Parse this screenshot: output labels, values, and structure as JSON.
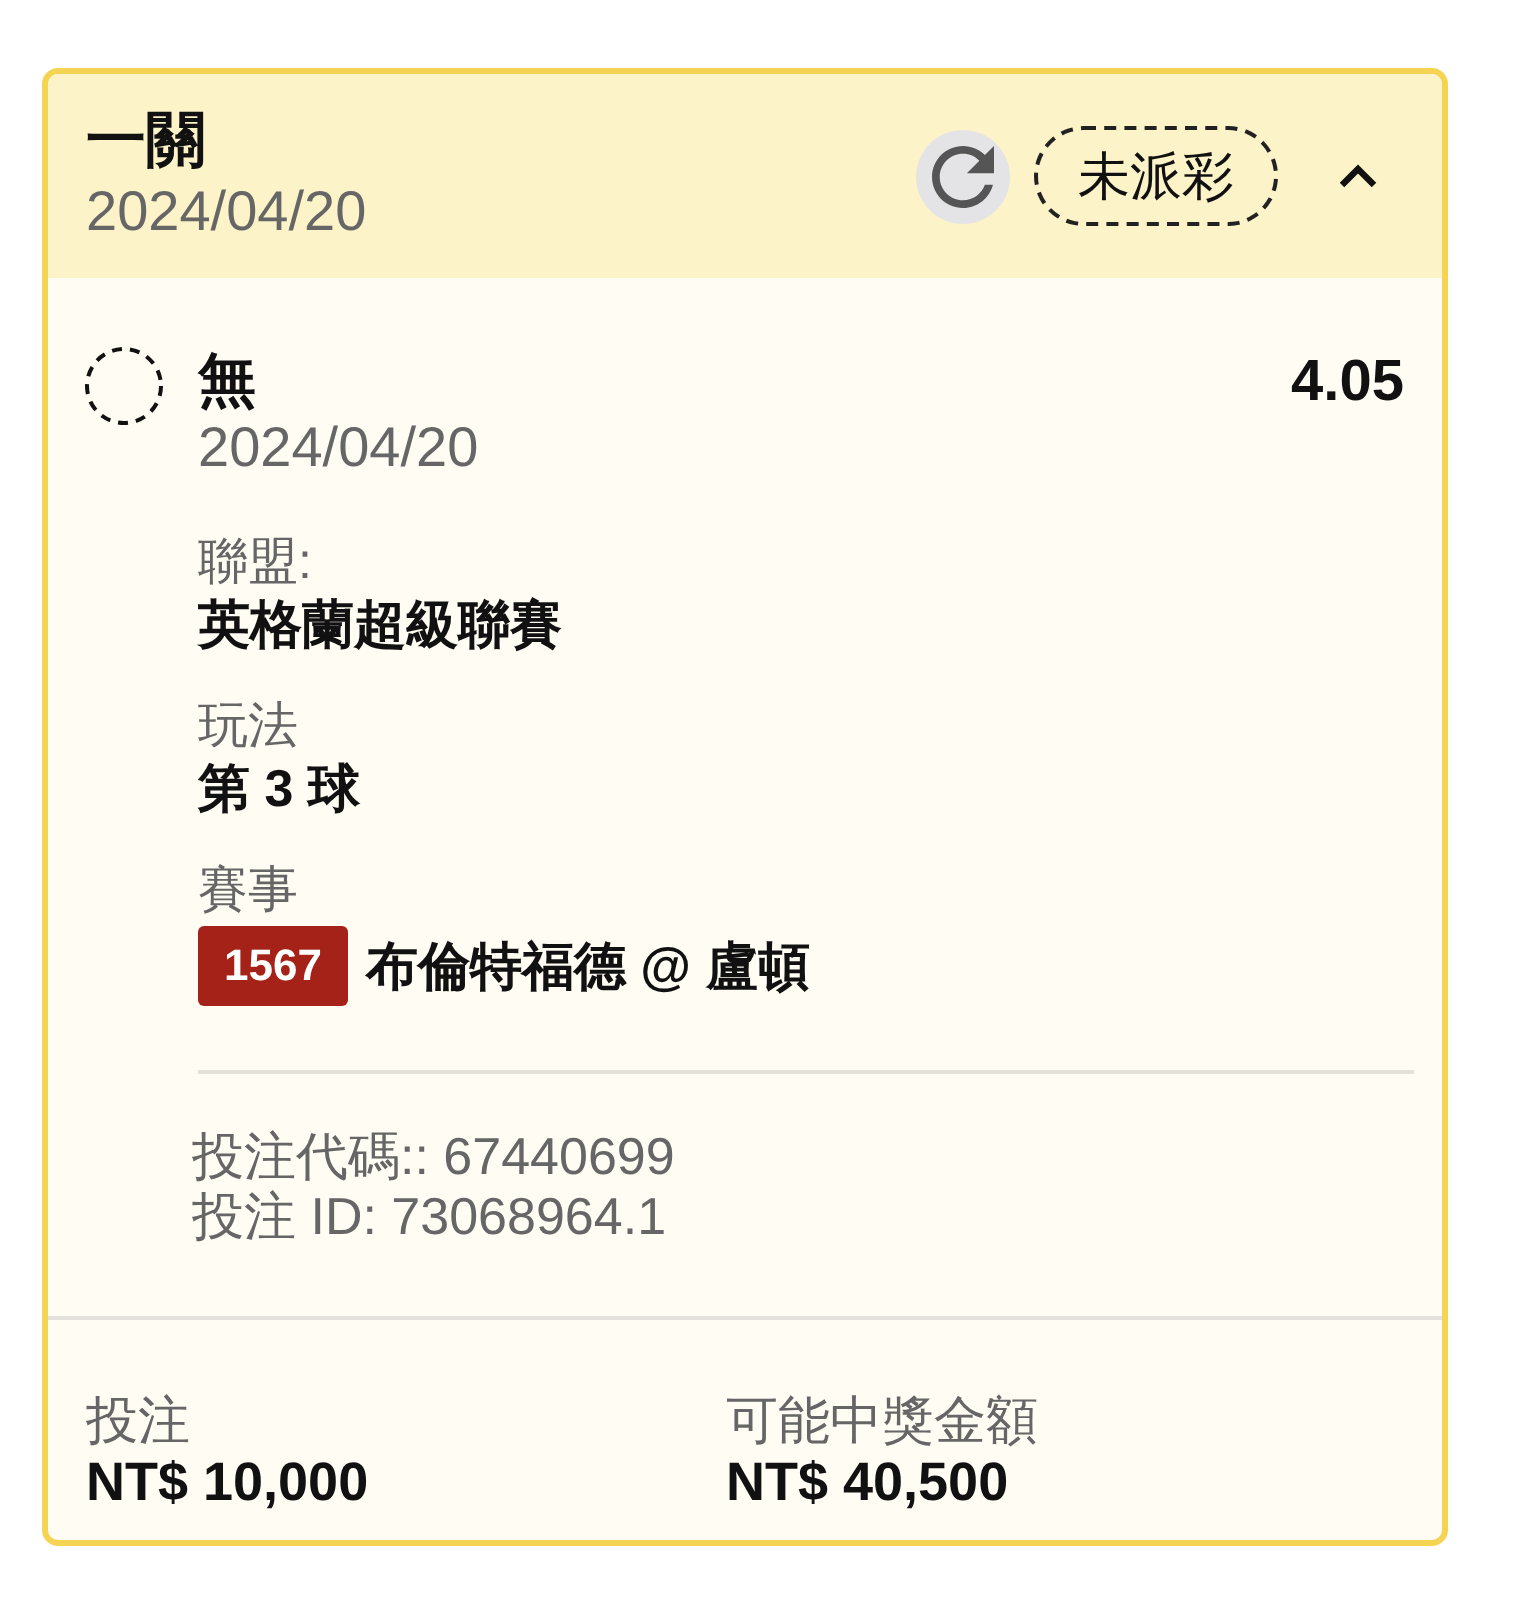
{
  "bet": {
    "title": "一關",
    "date": "2024/04/20",
    "status": "未派彩",
    "expanded": true
  },
  "selections": [
    {
      "name": "無",
      "date": "2024/04/20",
      "odds": "4.05",
      "settled": false,
      "details": [
        {
          "label": "聯盟:",
          "value": "英格蘭超級聯賽"
        },
        {
          "label": "玩法",
          "value": "第 3 球"
        },
        {
          "label": "賽事",
          "event_code": "1567",
          "value": "布倫特福德 @ 盧頓"
        }
      ]
    }
  ],
  "references": [
    "投注代碼:: 67440699",
    "投注 ID: 73068964.1"
  ],
  "totals": [
    {
      "label": "投注",
      "amount": "NT$ 10,000"
    },
    {
      "label": "可能中獎金額",
      "amount": "NT$ 40,500"
    }
  ]
}
